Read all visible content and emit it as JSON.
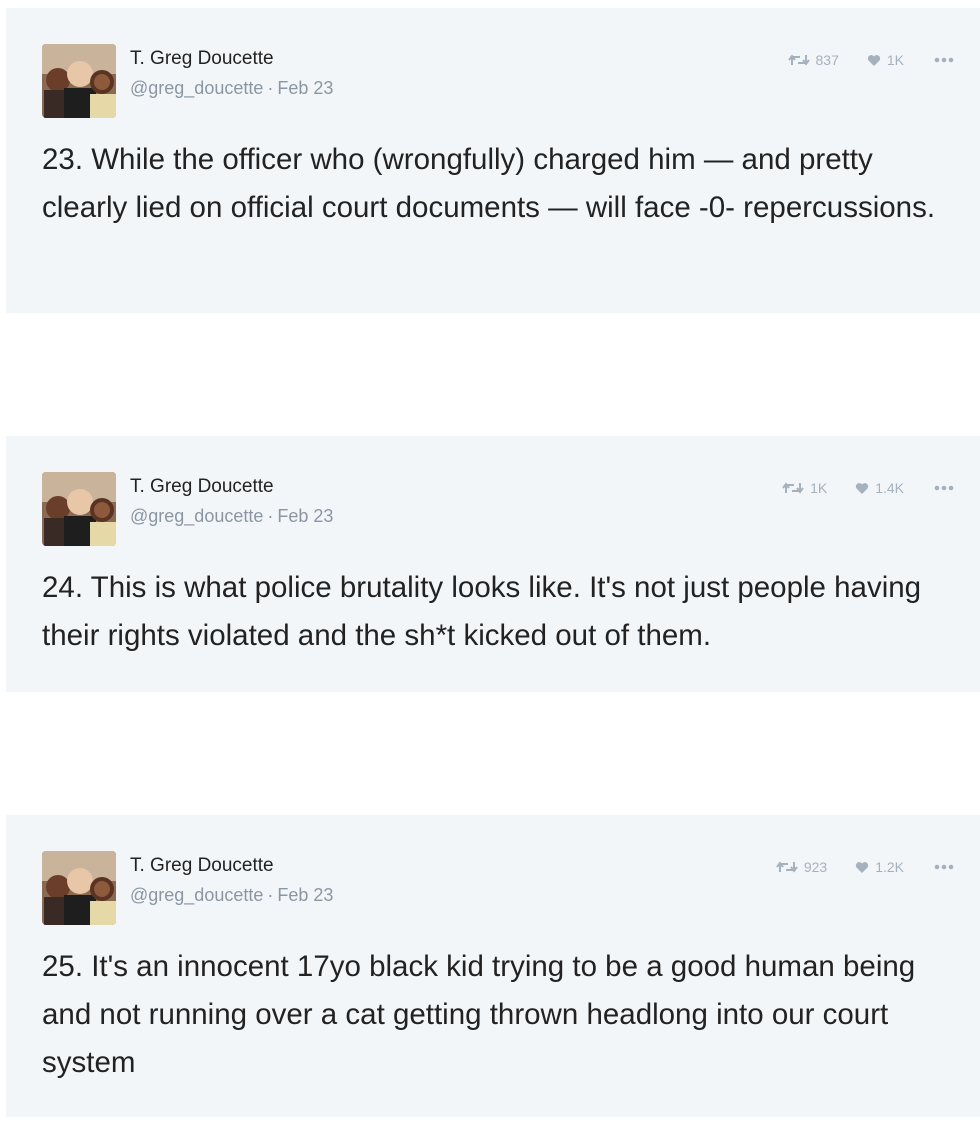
{
  "tweets": [
    {
      "author": {
        "name": "T. Greg Doucette",
        "handle": "@greg_doucette"
      },
      "date": "Feb 23",
      "separator": "·",
      "retweets": "837",
      "likes": "1K",
      "text": "23. While the officer who (wrongfully) charged him — and pretty clearly lied on official court documents — will face -0- repercussions."
    },
    {
      "author": {
        "name": "T. Greg Doucette",
        "handle": "@greg_doucette"
      },
      "date": "Feb 23",
      "separator": "·",
      "retweets": "1K",
      "likes": "1.4K",
      "text": "24. This is what police brutality looks like. It's not just people having their rights violated and the sh*t kicked out of them."
    },
    {
      "author": {
        "name": "T. Greg Doucette",
        "handle": "@greg_doucette"
      },
      "date": "Feb 23",
      "separator": "·",
      "retweets": "923",
      "likes": "1.2K",
      "text": "25. It's an innocent 17yo black kid trying to be a good human being and not running over a cat getting thrown headlong into our court system"
    }
  ],
  "icons": {
    "retweet": "retweet-icon",
    "like": "heart-icon",
    "more": "more-icon",
    "avatar": "avatar"
  },
  "colors": {
    "card_background": "#f3f6f9",
    "text": "#222222",
    "meta": "#8a96a2",
    "action_icon": "#a5b1bc"
  }
}
